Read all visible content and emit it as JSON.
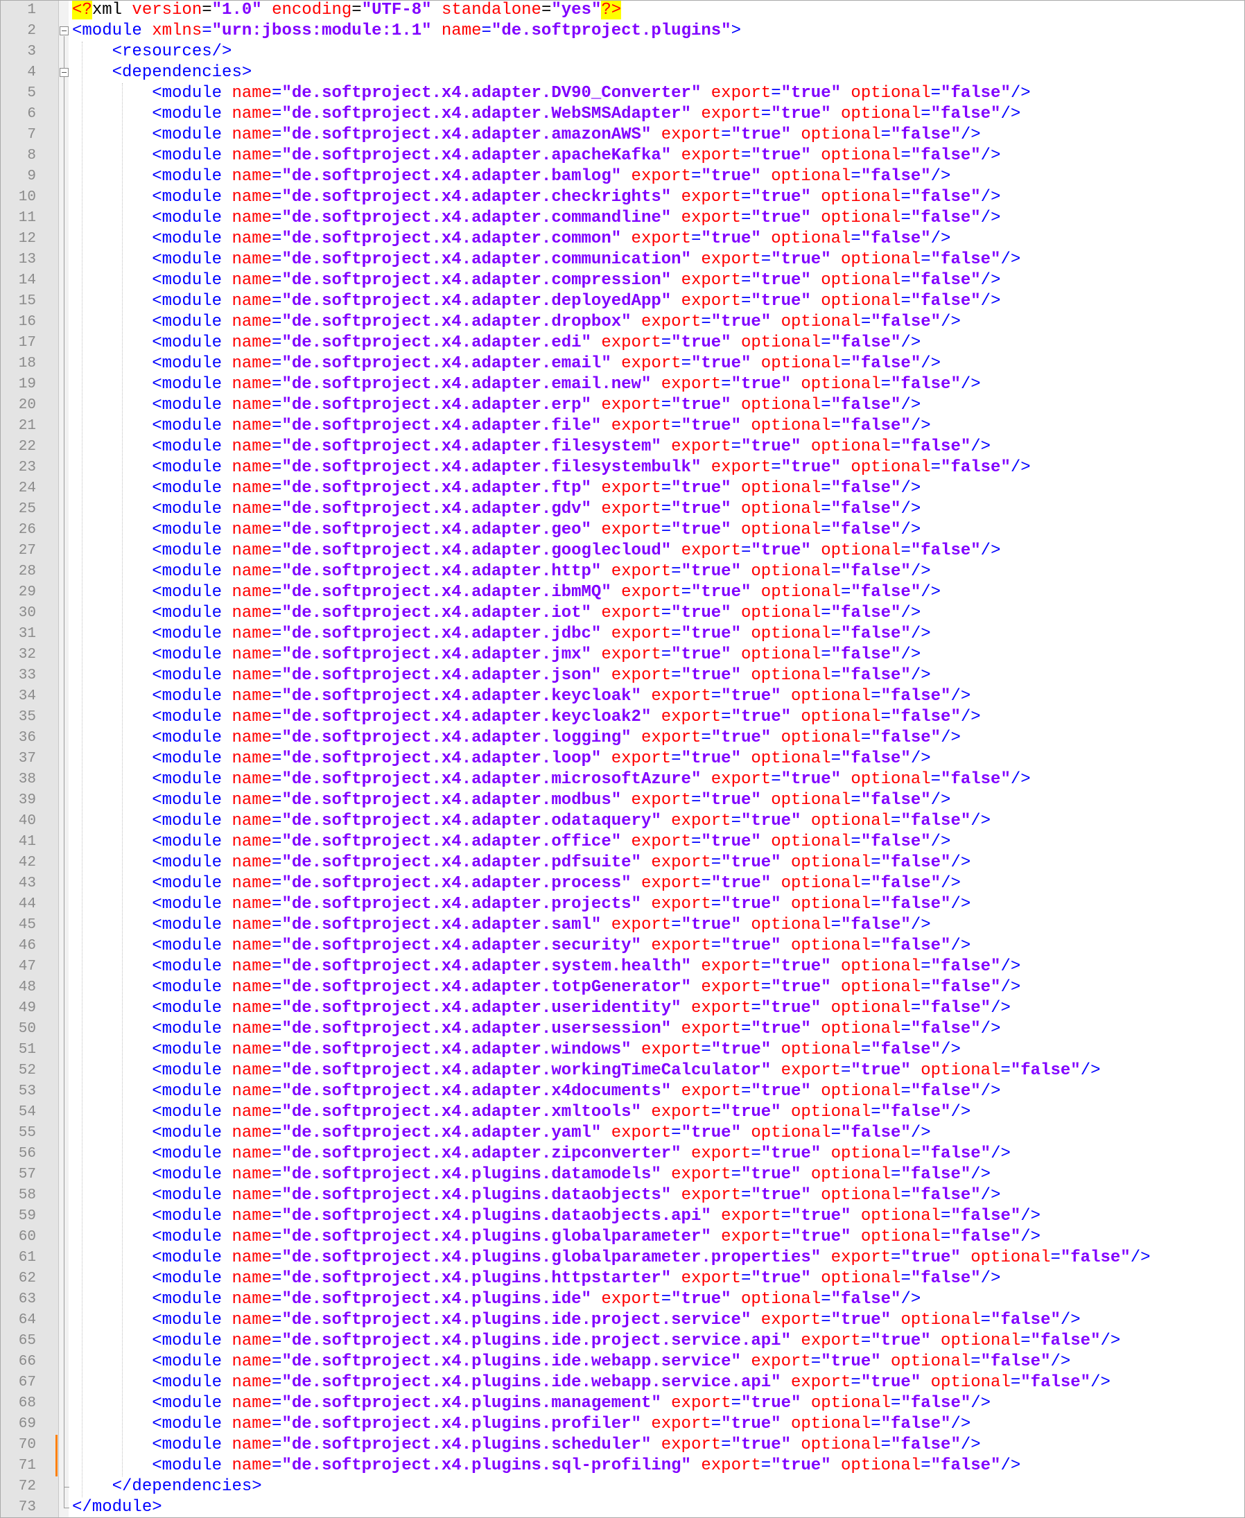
{
  "editor": {
    "lines": [
      {
        "n": "1",
        "t": [
          [
            "pi",
            "<?"
          ],
          [
            "k",
            "xml "
          ],
          [
            "r",
            "version"
          ],
          [
            "k",
            "="
          ],
          [
            "v",
            "\"1.0\""
          ],
          [
            "k",
            " "
          ],
          [
            "r",
            "encoding"
          ],
          [
            "k",
            "="
          ],
          [
            "v",
            "\"UTF-8\""
          ],
          [
            "k",
            " "
          ],
          [
            "r",
            "standalone"
          ],
          [
            "k",
            "="
          ],
          [
            "v",
            "\"yes\""
          ],
          [
            "pi",
            "?>"
          ]
        ]
      },
      {
        "n": "2",
        "t": [
          [
            "b",
            "<module "
          ],
          [
            "r",
            "xmlns"
          ],
          [
            "b",
            "="
          ],
          [
            "v",
            "\"urn:jboss:module:1.1\""
          ],
          [
            "b",
            " "
          ],
          [
            "r",
            "name"
          ],
          [
            "b",
            "="
          ],
          [
            "v",
            "\"de.softproject.plugins\""
          ],
          [
            "b",
            ">"
          ]
        ]
      },
      {
        "n": "3",
        "t": [
          [
            "b",
            "    <resources/>"
          ]
        ]
      },
      {
        "n": "4",
        "t": [
          [
            "b",
            "    <dependencies>"
          ]
        ]
      },
      {
        "n": "5",
        "m": "de.softproject.x4.adapter.DV90_Converter"
      },
      {
        "n": "6",
        "m": "de.softproject.x4.adapter.WebSMSAdapter"
      },
      {
        "n": "7",
        "m": "de.softproject.x4.adapter.amazonAWS"
      },
      {
        "n": "8",
        "m": "de.softproject.x4.adapter.apacheKafka"
      },
      {
        "n": "9",
        "m": "de.softproject.x4.adapter.bamlog"
      },
      {
        "n": "10",
        "m": "de.softproject.x4.adapter.checkrights"
      },
      {
        "n": "11",
        "m": "de.softproject.x4.adapter.commandline"
      },
      {
        "n": "12",
        "m": "de.softproject.x4.adapter.common"
      },
      {
        "n": "13",
        "m": "de.softproject.x4.adapter.communication"
      },
      {
        "n": "14",
        "m": "de.softproject.x4.adapter.compression"
      },
      {
        "n": "15",
        "m": "de.softproject.x4.adapter.deployedApp"
      },
      {
        "n": "16",
        "m": "de.softproject.x4.adapter.dropbox"
      },
      {
        "n": "17",
        "m": "de.softproject.x4.adapter.edi"
      },
      {
        "n": "18",
        "m": "de.softproject.x4.adapter.email"
      },
      {
        "n": "19",
        "m": "de.softproject.x4.adapter.email.new"
      },
      {
        "n": "20",
        "m": "de.softproject.x4.adapter.erp"
      },
      {
        "n": "21",
        "m": "de.softproject.x4.adapter.file"
      },
      {
        "n": "22",
        "m": "de.softproject.x4.adapter.filesystem"
      },
      {
        "n": "23",
        "m": "de.softproject.x4.adapter.filesystembulk"
      },
      {
        "n": "24",
        "m": "de.softproject.x4.adapter.ftp"
      },
      {
        "n": "25",
        "m": "de.softproject.x4.adapter.gdv"
      },
      {
        "n": "26",
        "m": "de.softproject.x4.adapter.geo"
      },
      {
        "n": "27",
        "m": "de.softproject.x4.adapter.googlecloud"
      },
      {
        "n": "28",
        "m": "de.softproject.x4.adapter.http"
      },
      {
        "n": "29",
        "m": "de.softproject.x4.adapter.ibmMQ"
      },
      {
        "n": "30",
        "m": "de.softproject.x4.adapter.iot"
      },
      {
        "n": "31",
        "m": "de.softproject.x4.adapter.jdbc"
      },
      {
        "n": "32",
        "m": "de.softproject.x4.adapter.jmx"
      },
      {
        "n": "33",
        "m": "de.softproject.x4.adapter.json"
      },
      {
        "n": "34",
        "m": "de.softproject.x4.adapter.keycloak"
      },
      {
        "n": "35",
        "m": "de.softproject.x4.adapter.keycloak2"
      },
      {
        "n": "36",
        "m": "de.softproject.x4.adapter.logging"
      },
      {
        "n": "37",
        "m": "de.softproject.x4.adapter.loop"
      },
      {
        "n": "38",
        "m": "de.softproject.x4.adapter.microsoftAzure"
      },
      {
        "n": "39",
        "m": "de.softproject.x4.adapter.modbus"
      },
      {
        "n": "40",
        "m": "de.softproject.x4.adapter.odataquery"
      },
      {
        "n": "41",
        "m": "de.softproject.x4.adapter.office"
      },
      {
        "n": "42",
        "m": "de.softproject.x4.adapter.pdfsuite"
      },
      {
        "n": "43",
        "m": "de.softproject.x4.adapter.process"
      },
      {
        "n": "44",
        "m": "de.softproject.x4.adapter.projects"
      },
      {
        "n": "45",
        "m": "de.softproject.x4.adapter.saml"
      },
      {
        "n": "46",
        "m": "de.softproject.x4.adapter.security"
      },
      {
        "n": "47",
        "m": "de.softproject.x4.adapter.system.health"
      },
      {
        "n": "48",
        "m": "de.softproject.x4.adapter.totpGenerator"
      },
      {
        "n": "49",
        "m": "de.softproject.x4.adapter.useridentity"
      },
      {
        "n": "50",
        "m": "de.softproject.x4.adapter.usersession"
      },
      {
        "n": "51",
        "m": "de.softproject.x4.adapter.windows"
      },
      {
        "n": "52",
        "m": "de.softproject.x4.adapter.workingTimeCalculator"
      },
      {
        "n": "53",
        "m": "de.softproject.x4.adapter.x4documents"
      },
      {
        "n": "54",
        "m": "de.softproject.x4.adapter.xmltools"
      },
      {
        "n": "55",
        "m": "de.softproject.x4.adapter.yaml"
      },
      {
        "n": "56",
        "m": "de.softproject.x4.adapter.zipconverter"
      },
      {
        "n": "57",
        "m": "de.softproject.x4.plugins.datamodels"
      },
      {
        "n": "58",
        "m": "de.softproject.x4.plugins.dataobjects"
      },
      {
        "n": "59",
        "m": "de.softproject.x4.plugins.dataobjects.api"
      },
      {
        "n": "60",
        "m": "de.softproject.x4.plugins.globalparameter"
      },
      {
        "n": "61",
        "m": "de.softproject.x4.plugins.globalparameter.properties"
      },
      {
        "n": "62",
        "m": "de.softproject.x4.plugins.httpstarter"
      },
      {
        "n": "63",
        "m": "de.softproject.x4.plugins.ide"
      },
      {
        "n": "64",
        "m": "de.softproject.x4.plugins.ide.project.service"
      },
      {
        "n": "65",
        "m": "de.softproject.x4.plugins.ide.project.service.api"
      },
      {
        "n": "66",
        "m": "de.softproject.x4.plugins.ide.webapp.service"
      },
      {
        "n": "67",
        "m": "de.softproject.x4.plugins.ide.webapp.service.api"
      },
      {
        "n": "68",
        "m": "de.softproject.x4.plugins.management"
      },
      {
        "n": "69",
        "m": "de.softproject.x4.plugins.profiler"
      },
      {
        "n": "70",
        "m": "de.softproject.x4.plugins.scheduler"
      },
      {
        "n": "71",
        "m": "de.softproject.x4.plugins.sql-profiling"
      },
      {
        "n": "72",
        "t": [
          [
            "b",
            "    </dependencies>"
          ]
        ]
      },
      {
        "n": "73",
        "t": [
          [
            "b",
            "</module>"
          ]
        ]
      }
    ],
    "module_line": {
      "indent": "        ",
      "tag_open": "<module ",
      "name_attr": "name",
      "eq": "=",
      "export_attr": "export",
      "export_value": "\"true\"",
      "optional_attr": "optional",
      "optional_value": "\"false\"",
      "tag_close": "/>"
    },
    "changed_lines": [
      "70",
      "71"
    ],
    "colors": {
      "tag": "#0000ff",
      "attribute": "#ff0000",
      "value": "#8000ff",
      "gutter": "#e4e4e4",
      "line_number": "#8b8b8b",
      "change_marker": "#ff8000",
      "pi_highlight": "#ffff00"
    }
  }
}
